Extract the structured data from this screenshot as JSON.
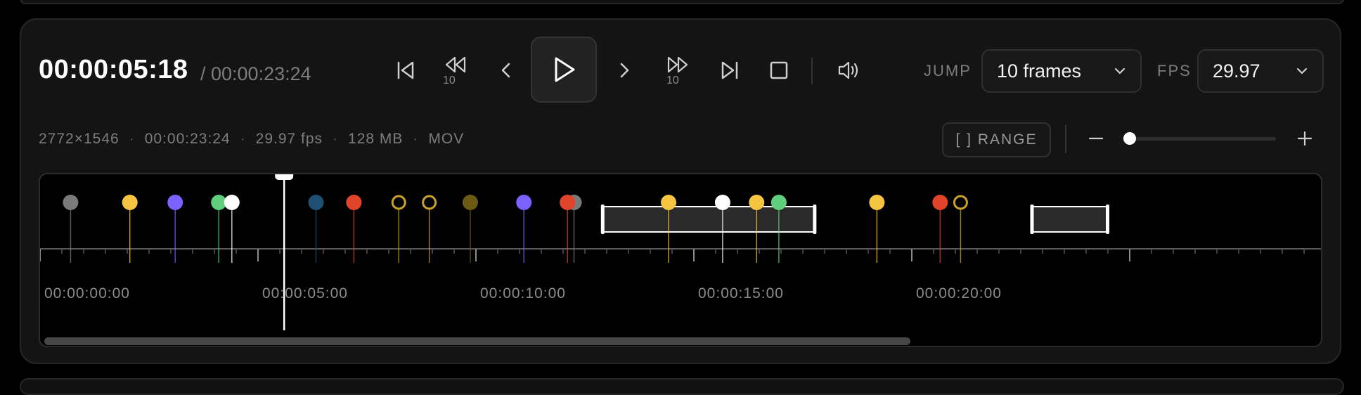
{
  "player": {
    "current_timecode": "00:00:05:18",
    "total_timecode": "/ 00:00:23:24",
    "skip_back_count": "10",
    "skip_forward_count": "10",
    "jump_label": "JUMP",
    "jump_value": "10 frames",
    "fps_label": "FPS",
    "fps_value": "29.97"
  },
  "meta": {
    "resolution": "2772×1546",
    "duration": "00:00:23:24",
    "framerate": "29.97 fps",
    "size": "128 MB",
    "format": "MOV"
  },
  "toolbar": {
    "range_label": "[ ] RANGE",
    "zoom_level": 0.0
  },
  "timeline": {
    "duration_seconds": 23.8,
    "playhead_seconds": 5.6,
    "scroll_thumb_fraction": 0.68,
    "tick_labels": [
      "00:00:00:00",
      "00:00:05:00",
      "00:00:10:00",
      "00:00:15:00",
      "00:00:20:00"
    ],
    "tick_seconds": [
      0,
      5,
      10,
      15,
      20
    ],
    "markers": [
      {
        "t": 0.7,
        "color": "#7a7a7a",
        "style": "filled"
      },
      {
        "t": 2.06,
        "color": "#f5c542",
        "style": "filled"
      },
      {
        "t": 3.1,
        "color": "#7b61ff",
        "style": "filled"
      },
      {
        "t": 4.1,
        "color": "#5fcf7d",
        "style": "filled"
      },
      {
        "t": 4.4,
        "color": "#ffffff",
        "style": "filled"
      },
      {
        "t": 6.33,
        "color": "#1f4f72",
        "style": "filled"
      },
      {
        "t": 7.2,
        "color": "#e0452a",
        "style": "filled"
      },
      {
        "t": 8.23,
        "color": "#c9a227",
        "style": "ring"
      },
      {
        "t": 8.93,
        "color": "#c9a227",
        "style": "ring"
      },
      {
        "t": 9.87,
        "color": "#6b5a13",
        "style": "filled"
      },
      {
        "t": 11.1,
        "color": "#7b61ff",
        "style": "filled"
      },
      {
        "t": 12.25,
        "color": "#7a7a7a",
        "style": "filled"
      },
      {
        "t": 12.1,
        "color": "#e0452a",
        "style": "filled"
      },
      {
        "t": 14.42,
        "color": "#f5c542",
        "style": "filled"
      },
      {
        "t": 15.66,
        "color": "#ffffff",
        "style": "filled"
      },
      {
        "t": 16.44,
        "color": "#f5c542",
        "style": "filled"
      },
      {
        "t": 16.95,
        "color": "#5fcf7d",
        "style": "filled"
      },
      {
        "t": 19.2,
        "color": "#f5c542",
        "style": "filled"
      },
      {
        "t": 20.65,
        "color": "#e0452a",
        "style": "filled"
      },
      {
        "t": 21.12,
        "color": "#c9a227",
        "style": "ring"
      }
    ],
    "ranges": [
      {
        "start": 12.9,
        "end": 17.78
      },
      {
        "start": 22.75,
        "end": 24.5
      }
    ]
  },
  "colors": {
    "panel": "#141414",
    "accent_white": "#ffffff"
  }
}
